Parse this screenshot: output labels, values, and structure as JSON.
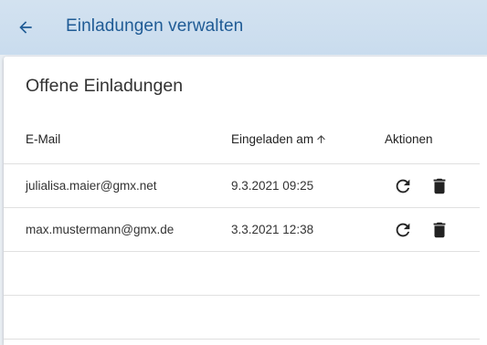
{
  "toolbar": {
    "back_icon": "arrow-left-icon",
    "title": "Einladungen verwalten"
  },
  "card": {
    "title": "Offene Einladungen"
  },
  "table": {
    "columns": {
      "email": "E-Mail",
      "invited_at": "Eingeladen am",
      "actions": "Aktionen"
    },
    "sort": {
      "column": "invited_at",
      "direction": "ascending",
      "icon": "arrow-up-icon"
    },
    "rows": [
      {
        "email": "julialisa.maier@gmx.net",
        "invited_at": "9.3.2021 09:25"
      },
      {
        "email": "max.mustermann@gmx.de",
        "invited_at": "3.3.2021 12:38"
      }
    ],
    "row_actions": [
      {
        "icon": "refresh-icon",
        "action": "resend"
      },
      {
        "icon": "trash-icon",
        "action": "delete"
      }
    ]
  },
  "colors": {
    "toolbar_bg": "#cfe0f0",
    "toolbar_text": "#1f5b95",
    "divider": "#e0e0e0"
  }
}
